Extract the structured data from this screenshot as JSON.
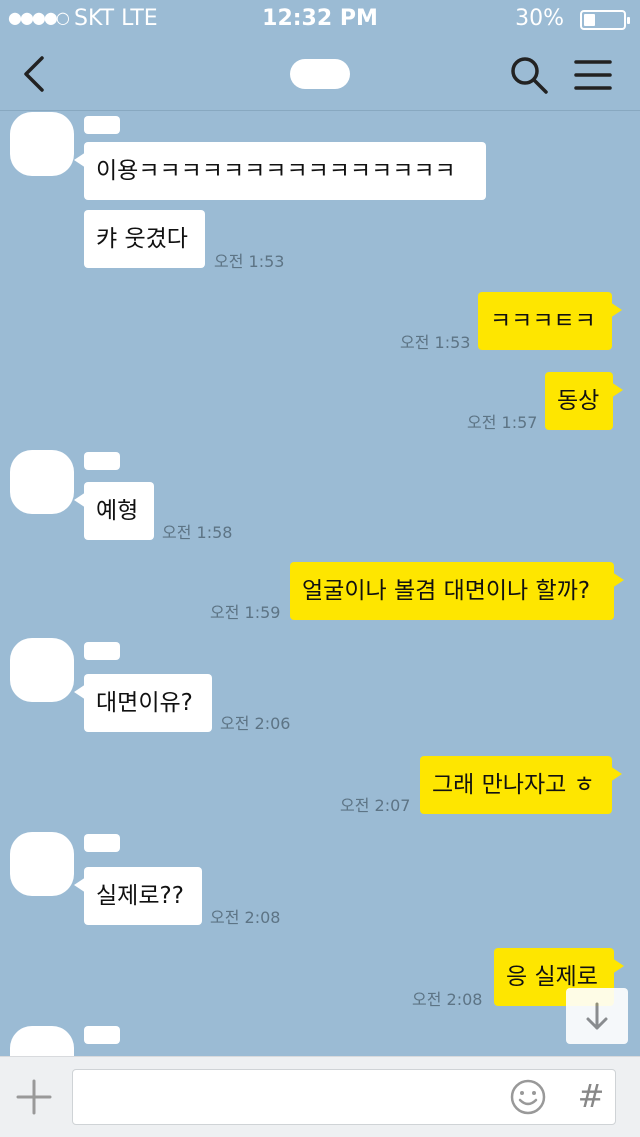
{
  "status_bar": {
    "signal": "●●●●○",
    "carrier": "SKT LTE",
    "time": "12:32 PM",
    "battery": "30%",
    "battery_level": 0.3
  },
  "header": {
    "back_icon": "chevron-left-icon",
    "search_icon": "search-icon",
    "menu_icon": "hamburger-menu-icon"
  },
  "messages": [
    {
      "dir": "in",
      "text": "이용ㅋㅋㅋㅋㅋㅋㅋㅋㅋㅋㅋㅋㅋㅋㅋ",
      "time": ""
    },
    {
      "dir": "in",
      "text": "캬 웃겼다",
      "time": "오전 1:53"
    },
    {
      "dir": "out",
      "text": "ㅋㅋㅋㅌㅋ",
      "time": "오전 1:53"
    },
    {
      "dir": "out",
      "text": "동상",
      "time": "오전 1:57"
    },
    {
      "dir": "in",
      "text": "예형",
      "time": "오전 1:58"
    },
    {
      "dir": "out",
      "text": "얼굴이나 볼겸 대면이나 할까?",
      "time": "오전 1:59"
    },
    {
      "dir": "in",
      "text": "대면이유?",
      "time": "오전 2:06"
    },
    {
      "dir": "out",
      "text": "그래 만나자고 ㅎ",
      "time": "오전 2:07"
    },
    {
      "dir": "in",
      "text": "실제로??",
      "time": "오전 2:08"
    },
    {
      "dir": "out",
      "text": "응 실제로",
      "time": "오전 2:08"
    }
  ],
  "input_bar": {
    "placeholder": "",
    "hash": "#",
    "plus_icon": "plus-icon",
    "emoji_icon": "emoji-icon"
  },
  "colors": {
    "background": "#9bbbd4",
    "outgoing_bubble": "#fee600",
    "incoming_bubble": "#ffffff"
  }
}
